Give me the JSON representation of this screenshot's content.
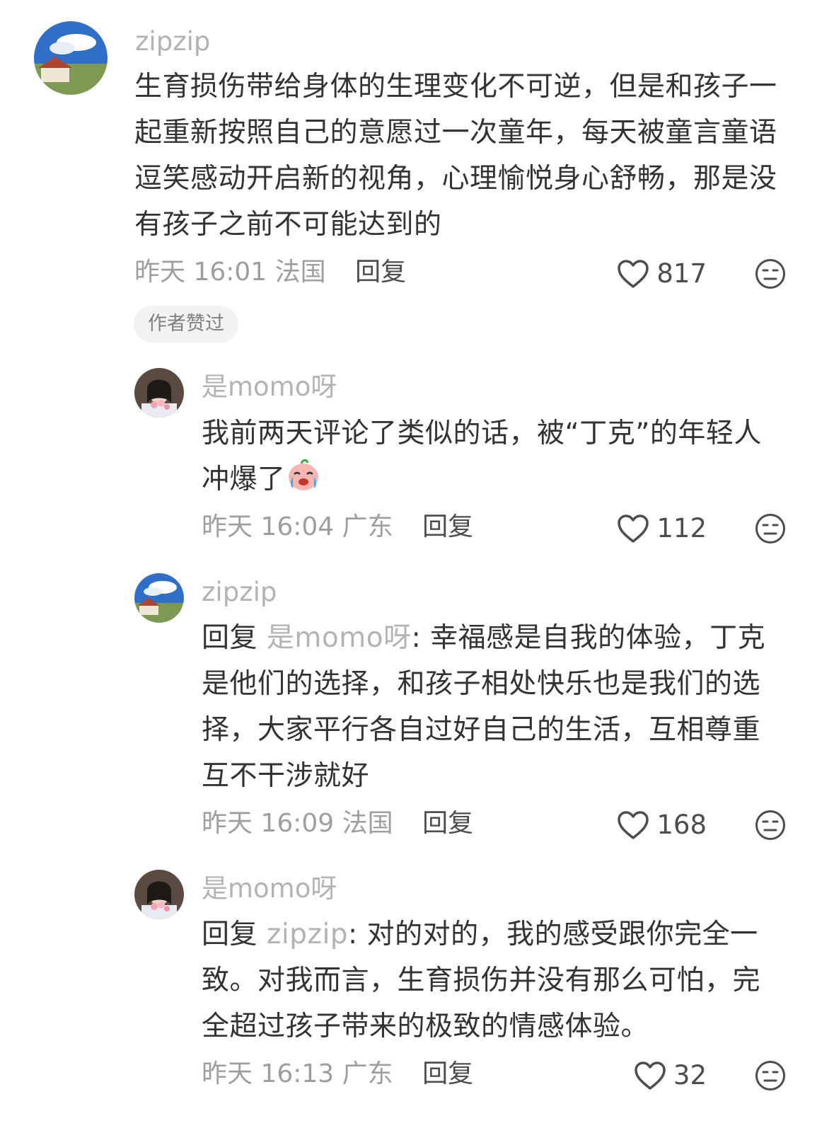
{
  "comments": [
    {
      "user": "zipzip",
      "text": "生育损伤带给身体的生理变化不可逆，但是和孩子一起重新按照自己的意愿过一次童年，每天被童言童语逗笑感动开启新的视角，心理愉悦身心舒畅，那是没有孩子之前不可能达到的",
      "time": "昨天 16:01",
      "location": "法国",
      "reply_label": "回复",
      "likes": "817",
      "badge": "作者赞过"
    },
    {
      "user": "是momo呀",
      "text": "我前两天评论了类似的话，被“丁克”的年轻人冲爆了",
      "emoji": "crying-face-emoji",
      "time": "昨天 16:04",
      "location": "广东",
      "reply_label": "回复",
      "likes": "112"
    },
    {
      "user": "zipzip",
      "reply_prefix": "回复",
      "reply_to": "是momo呀",
      "text": ": 幸福感是自我的体验，丁克是他们的选择，和孩子相处快乐也是我们的选择，大家平行各自过好自己的生活，互相尊重互不干涉就好",
      "time": "昨天 16:09",
      "location": "法国",
      "reply_label": "回复",
      "likes": "168"
    },
    {
      "user": "是momo呀",
      "reply_prefix": "回复",
      "reply_to": "zipzip",
      "text": ": 对的对的，我的感受跟你完全一致。对我而言，生育损伤并没有那么可怕，完全超过孩子带来的极致的情感体验。",
      "time": "昨天 16:13",
      "location": "广东",
      "reply_label": "回复",
      "likes": "32"
    }
  ],
  "icons": {
    "like": "heart-outline-icon",
    "dislike": "meh-face-icon"
  }
}
